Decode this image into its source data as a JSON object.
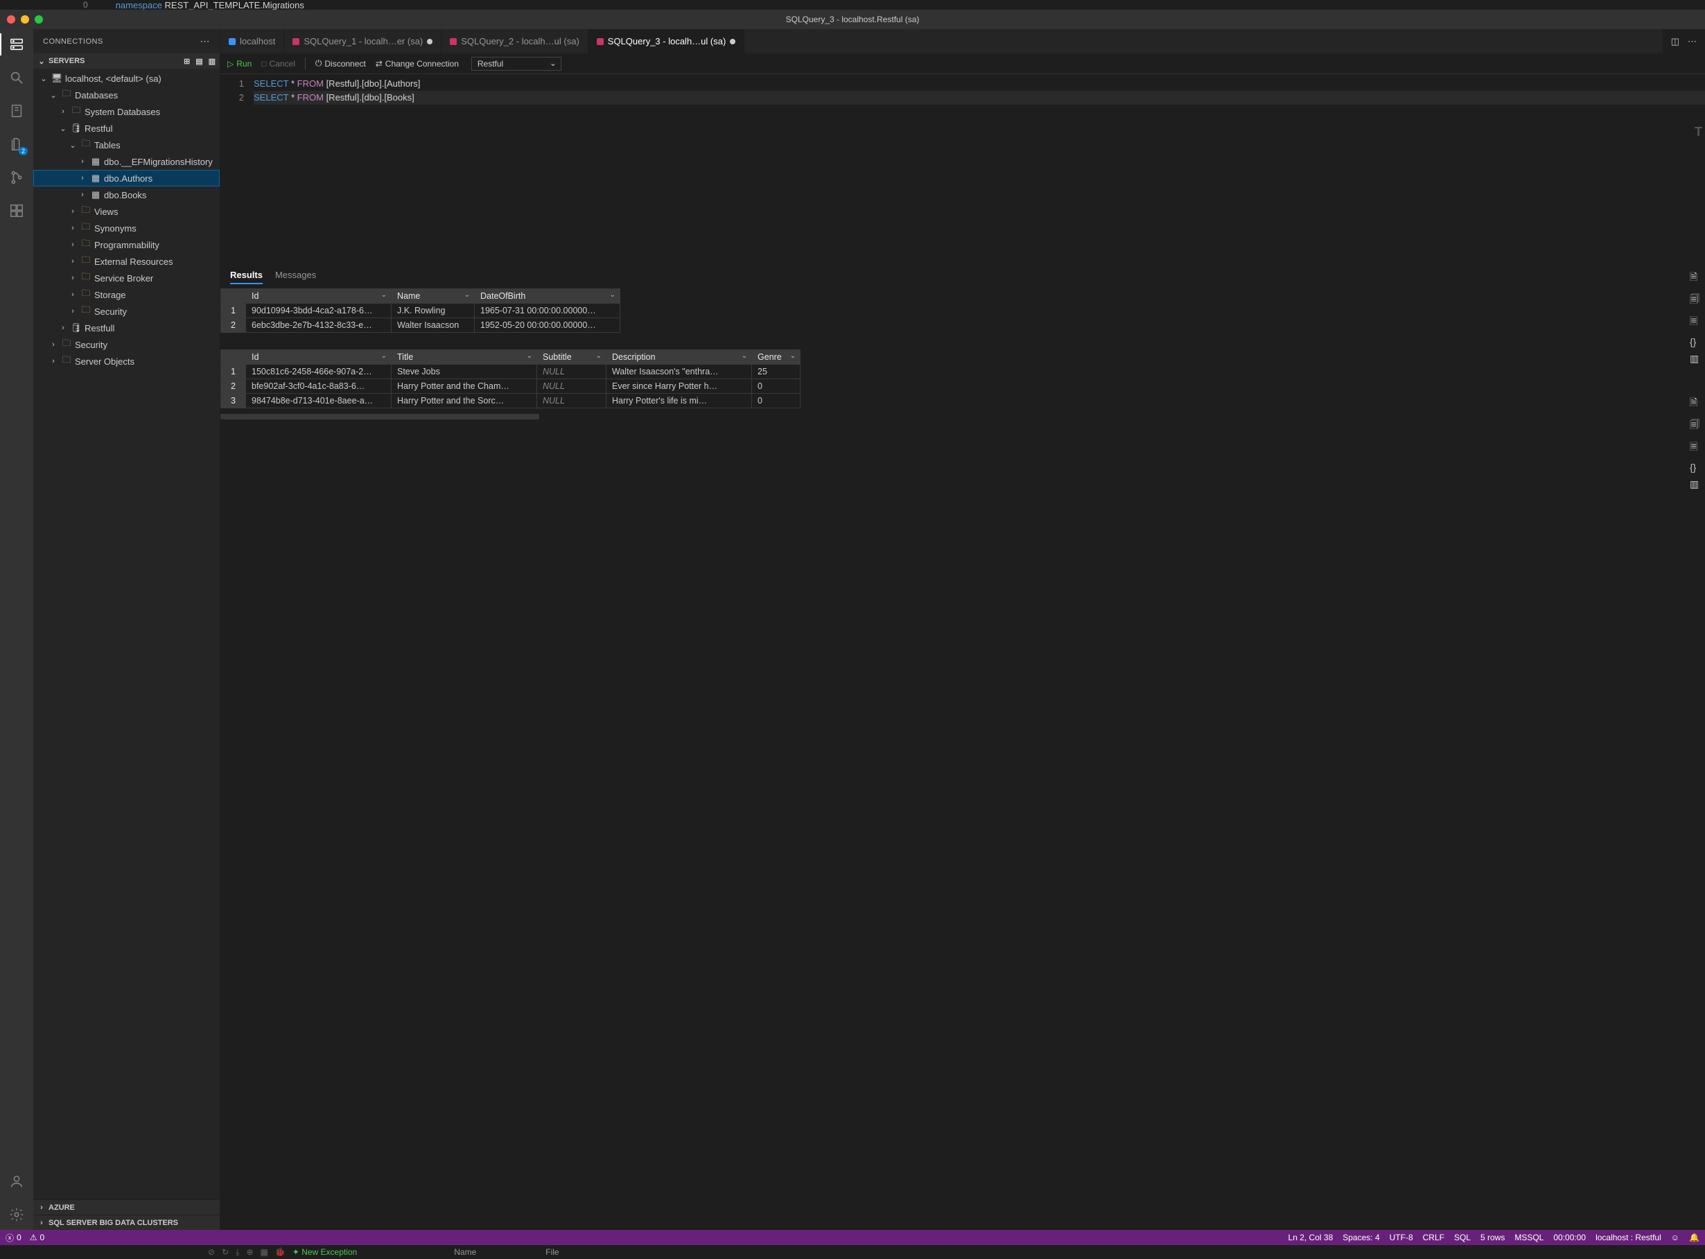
{
  "top_code": {
    "line_no": "0",
    "kw": "namespace",
    "rest": " REST_API_TEMPLATE.Migrations"
  },
  "titlebar": {
    "title": "SQLQuery_3 - localhost.Restful (sa)"
  },
  "activity_badge": "2",
  "sidebar": {
    "header": "CONNECTIONS",
    "section_servers": "SERVERS",
    "tree": {
      "host": "localhost, <default> (sa)",
      "databases": "Databases",
      "sysdb": "System Databases",
      "restful": "Restful",
      "tables": "Tables",
      "t_mig": "dbo.__EFMigrationsHistory",
      "t_auth": "dbo.Authors",
      "t_books": "dbo.Books",
      "views": "Views",
      "syn": "Synonyms",
      "prog": "Programmability",
      "ext": "External Resources",
      "sb": "Service Broker",
      "stor": "Storage",
      "sec": "Security",
      "restfull": "Restfull",
      "sec2": "Security",
      "srvobj": "Server Objects"
    },
    "azure": "AZURE",
    "bigdata": "SQL SERVER BIG DATA CLUSTERS"
  },
  "tabs": {
    "t1": "localhost",
    "t2": "SQLQuery_1 - localh…er (sa)",
    "t3": "SQLQuery_2 - localh…ul (sa)",
    "t4": "SQLQuery_3 - localh…ul (sa)"
  },
  "toolbar": {
    "run": "Run",
    "cancel": "Cancel",
    "disconnect": "Disconnect",
    "change": "Change Connection",
    "db": "Restful"
  },
  "code": {
    "l1_select": "SELECT",
    "l1_star": "*",
    "l1_from": "FROM",
    "l1_ref": "[Restful].[dbo].[Authors]",
    "l2_select": "SELECT",
    "l2_star": "*",
    "l2_from": "FROM",
    "l2_ref": "[Restful].[dbo].[Books]"
  },
  "results": {
    "tab_results": "Results",
    "tab_messages": "Messages",
    "grid1": {
      "cols": [
        "Id",
        "Name",
        "DateOfBirth"
      ],
      "rows": [
        [
          "1",
          "90d10994-3bdd-4ca2-a178-6…",
          "J.K. Rowling",
          "1965-07-31 00:00:00.00000…"
        ],
        [
          "2",
          "6ebc3dbe-2e7b-4132-8c33-e…",
          "Walter Isaacson",
          "1952-05-20 00:00:00.00000…"
        ]
      ]
    },
    "grid2": {
      "cols": [
        "Id",
        "Title",
        "Subtitle",
        "Description",
        "Genre"
      ],
      "rows": [
        [
          "1",
          "150c81c6-2458-466e-907a-2…",
          "Steve Jobs",
          "NULL",
          "Walter Isaacson's \"enthra…",
          "25"
        ],
        [
          "2",
          "bfe902af-3cf0-4a1c-8a83-6…",
          "Harry Potter and the Cham…",
          "NULL",
          "Ever since Harry Potter h…",
          "0"
        ],
        [
          "3",
          "98474b8e-d713-401e-8aee-a…",
          "Harry Potter and the Sorc…",
          "NULL",
          "Harry Potter's life is mi…",
          "0"
        ]
      ]
    }
  },
  "status": {
    "errors": "0",
    "warnings": "0",
    "lncol": "Ln 2, Col 38",
    "spaces": "Spaces: 4",
    "enc": "UTF-8",
    "eol": "CRLF",
    "lang": "SQL",
    "rows": "5 rows",
    "mssql": "MSSQL",
    "time": "00:00:00",
    "conn": "localhost : Restful"
  },
  "debug": {
    "new_exc": "New Exception",
    "name": "Name",
    "file": "File"
  },
  "chart_data": {
    "type": "table",
    "tables": [
      {
        "name": "Authors",
        "columns": [
          "Id",
          "Name",
          "DateOfBirth"
        ],
        "rows": [
          [
            "90d10994-3bdd-4ca2-a178-6…",
            "J.K. Rowling",
            "1965-07-31 00:00:00.00000…"
          ],
          [
            "6ebc3dbe-2e7b-4132-8c33-e…",
            "Walter Isaacson",
            "1952-05-20 00:00:00.00000…"
          ]
        ]
      },
      {
        "name": "Books",
        "columns": [
          "Id",
          "Title",
          "Subtitle",
          "Description",
          "Genre"
        ],
        "rows": [
          [
            "150c81c6-2458-466e-907a-2…",
            "Steve Jobs",
            null,
            "Walter Isaacson's \"enthra…",
            25
          ],
          [
            "bfe902af-3cf0-4a1c-8a83-6…",
            "Harry Potter and the Cham…",
            null,
            "Ever since Harry Potter h…",
            0
          ],
          [
            "98474b8e-d713-401e-8aee-a…",
            "Harry Potter and the Sorc…",
            null,
            "Harry Potter's life is mi…",
            0
          ]
        ]
      }
    ]
  }
}
